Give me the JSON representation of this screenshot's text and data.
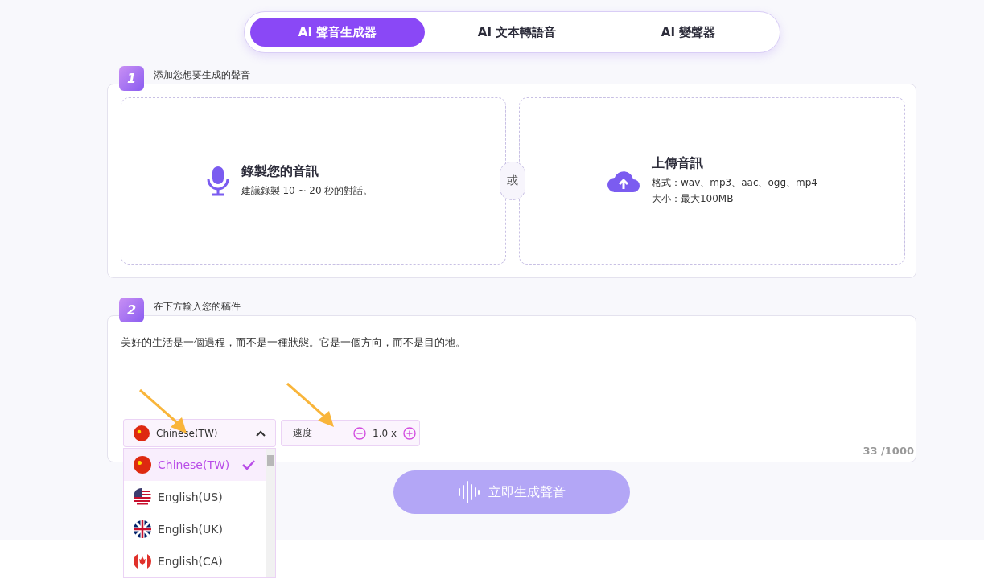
{
  "tabs": [
    {
      "label": "AI 聲音生成器",
      "selected": true
    },
    {
      "label": "AI 文本轉語音",
      "selected": false
    },
    {
      "label": "AI 變聲器",
      "selected": false
    }
  ],
  "step1": {
    "number": "1",
    "title": "添加您想要生成的聲音",
    "record": {
      "title": "錄製您的音訊",
      "hint": "建議錄製 10 ~ 20 秒的對話。"
    },
    "or": "或",
    "upload": {
      "title": "上傳音訊",
      "formats": "格式：wav、mp3、aac、ogg、mp4",
      "size": "大小：最大100MB"
    }
  },
  "step2": {
    "number": "2",
    "title": "在下方輸入您的稿件",
    "script": "美好的生活是一個過程，而不是一種狀態。它是一個方向，而不是目的地。",
    "language": {
      "value": "Chinese(TW)",
      "kind": "cn",
      "expanded": true,
      "options": [
        {
          "label": "Chinese(TW)",
          "kind": "cn",
          "selected": true
        },
        {
          "label": "English(US)",
          "kind": "us",
          "selected": false
        },
        {
          "label": "English(UK)",
          "kind": "gb",
          "selected": false
        },
        {
          "label": "English(CA)",
          "kind": "ca",
          "selected": false
        }
      ]
    },
    "speed": {
      "label": "速度",
      "value": "1.0 x"
    },
    "counter": "33 /1000"
  },
  "generate_button": "立即生成聲音"
}
